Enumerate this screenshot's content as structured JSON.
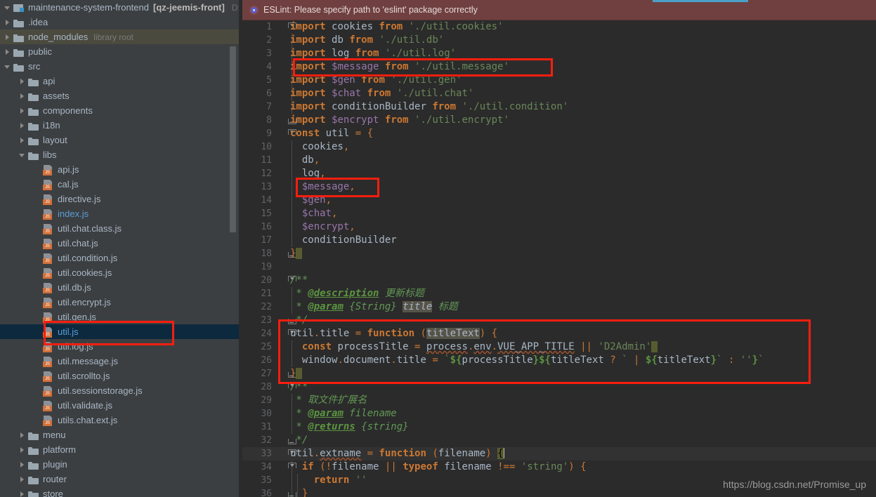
{
  "sidebar": {
    "root": {
      "name": "maintenance-system-frontend",
      "module": "[qz-jeemis-front]",
      "path": "D:\\c"
    },
    "items": [
      {
        "label": ".idea",
        "icon": "folder-icon",
        "arrow": "right",
        "indent": 1
      },
      {
        "label": "node_modules",
        "sub": "library root",
        "icon": "folder-icon",
        "arrow": "right",
        "indent": 1,
        "state": "hovered"
      },
      {
        "label": "public",
        "icon": "folder-icon",
        "arrow": "right",
        "indent": 1
      },
      {
        "label": "src",
        "icon": "folder-icon",
        "arrow": "down",
        "indent": 1
      },
      {
        "label": "api",
        "icon": "folder-icon",
        "arrow": "right",
        "indent": 2
      },
      {
        "label": "assets",
        "icon": "folder-icon",
        "arrow": "right",
        "indent": 2
      },
      {
        "label": "components",
        "icon": "folder-icon",
        "arrow": "right",
        "indent": 2
      },
      {
        "label": "i18n",
        "icon": "folder-icon",
        "arrow": "right",
        "indent": 2
      },
      {
        "label": "layout",
        "icon": "folder-icon",
        "arrow": "right",
        "indent": 2
      },
      {
        "label": "libs",
        "icon": "folder-icon",
        "arrow": "down",
        "indent": 2
      },
      {
        "label": "api.js",
        "icon": "js-file-icon",
        "arrow": "none",
        "indent": 3
      },
      {
        "label": "cal.js",
        "icon": "js-file-icon",
        "arrow": "none",
        "indent": 3
      },
      {
        "label": "directive.js",
        "icon": "js-file-icon",
        "arrow": "none",
        "indent": 3
      },
      {
        "label": "index.js",
        "icon": "js-file-icon",
        "arrow": "none",
        "indent": 3,
        "color": "blue"
      },
      {
        "label": "util.chat.class.js",
        "icon": "js-file-icon",
        "arrow": "none",
        "indent": 3
      },
      {
        "label": "util.chat.js",
        "icon": "js-file-icon",
        "arrow": "none",
        "indent": 3
      },
      {
        "label": "util.condition.js",
        "icon": "js-file-icon",
        "arrow": "none",
        "indent": 3
      },
      {
        "label": "util.cookies.js",
        "icon": "js-file-icon",
        "arrow": "none",
        "indent": 3
      },
      {
        "label": "util.db.js",
        "icon": "js-file-icon",
        "arrow": "none",
        "indent": 3
      },
      {
        "label": "util.encrypt.js",
        "icon": "js-file-icon",
        "arrow": "none",
        "indent": 3
      },
      {
        "label": "util.gen.js",
        "icon": "js-file-icon",
        "arrow": "none",
        "indent": 3
      },
      {
        "label": "util.js",
        "icon": "js-file-icon",
        "arrow": "none",
        "indent": 3,
        "color": "blue",
        "state": "selected"
      },
      {
        "label": "util.log.js",
        "icon": "js-file-icon",
        "arrow": "none",
        "indent": 3
      },
      {
        "label": "util.message.js",
        "icon": "js-file-icon",
        "arrow": "none",
        "indent": 3
      },
      {
        "label": "util.scrollto.js",
        "icon": "js-file-icon",
        "arrow": "none",
        "indent": 3
      },
      {
        "label": "util.sessionstorage.js",
        "icon": "js-file-icon",
        "arrow": "none",
        "indent": 3
      },
      {
        "label": "util.validate.js",
        "icon": "js-file-icon",
        "arrow": "none",
        "indent": 3
      },
      {
        "label": "utils.chat.ext.js",
        "icon": "js-file-icon",
        "arrow": "none",
        "indent": 3
      },
      {
        "label": "menu",
        "icon": "folder-icon",
        "arrow": "right",
        "indent": 2
      },
      {
        "label": "platform",
        "icon": "folder-icon",
        "arrow": "right",
        "indent": 2
      },
      {
        "label": "plugin",
        "icon": "folder-icon",
        "arrow": "right",
        "indent": 2
      },
      {
        "label": "router",
        "icon": "folder-icon",
        "arrow": "right",
        "indent": 2
      },
      {
        "label": "store",
        "icon": "folder-icon",
        "arrow": "right",
        "indent": 2
      }
    ]
  },
  "notification": {
    "text": "ESLint: Please specify path to 'eslint' package correctly",
    "icon": "error-circle-icon",
    "background": "#704040"
  },
  "editor": {
    "file": "util.js",
    "first_line": 1,
    "last_line": 36,
    "lines": [
      {
        "n": 1,
        "text": "import cookies from './util.cookies'"
      },
      {
        "n": 2,
        "text": "import db from './util.db'"
      },
      {
        "n": 3,
        "text": "import log from './util.log'"
      },
      {
        "n": 4,
        "text": "import $message from './util.message'"
      },
      {
        "n": 5,
        "text": "import $gen from './util.gen'"
      },
      {
        "n": 6,
        "text": "import $chat from './util.chat'"
      },
      {
        "n": 7,
        "text": "import conditionBuilder from './util.condition'"
      },
      {
        "n": 8,
        "text": "import $encrypt from './util.encrypt'"
      },
      {
        "n": 9,
        "text": "const util = {"
      },
      {
        "n": 10,
        "text": "  cookies,"
      },
      {
        "n": 11,
        "text": "  db,"
      },
      {
        "n": 12,
        "text": "  log,"
      },
      {
        "n": 13,
        "text": "  $message,"
      },
      {
        "n": 14,
        "text": "  $gen,"
      },
      {
        "n": 15,
        "text": "  $chat,"
      },
      {
        "n": 16,
        "text": "  $encrypt,"
      },
      {
        "n": 17,
        "text": "  conditionBuilder"
      },
      {
        "n": 18,
        "text": "}"
      },
      {
        "n": 19,
        "text": ""
      },
      {
        "n": 20,
        "text": "/**"
      },
      {
        "n": 21,
        "text": " * @description 更新标题"
      },
      {
        "n": 22,
        "text": " * @param {String} title 标题"
      },
      {
        "n": 23,
        "text": " */"
      },
      {
        "n": 24,
        "text": "util.title = function (titleText) {"
      },
      {
        "n": 25,
        "text": "  const processTitle = process.env.VUE_APP_TITLE || 'D2Admin'"
      },
      {
        "n": 26,
        "text": "  window.document.title = `${processTitle}${titleText ? ` | ${titleText}` : ''}`"
      },
      {
        "n": 27,
        "text": "}"
      },
      {
        "n": 28,
        "text": "/**"
      },
      {
        "n": 29,
        "text": " * 取文件扩展名"
      },
      {
        "n": 30,
        "text": " * @param filename"
      },
      {
        "n": 31,
        "text": " * @returns {string}"
      },
      {
        "n": 32,
        "text": " */"
      },
      {
        "n": 33,
        "text": "util.extname = function (filename) {"
      },
      {
        "n": 34,
        "text": "  if (!filename || typeof filename !== 'string') {"
      },
      {
        "n": 35,
        "text": "    return ''"
      },
      {
        "n": 36,
        "text": "  }"
      }
    ]
  },
  "annotations": {
    "color": "#fa1e0e",
    "boxes": [
      {
        "name": "import-message-highlight",
        "target_line": 4
      },
      {
        "name": "message-key-highlight",
        "target_line": 13
      },
      {
        "name": "util-title-function-highlight",
        "target_lines": "23-28"
      },
      {
        "name": "util-js-file-highlight",
        "target": "util.js"
      }
    ]
  },
  "watermark": {
    "text": "https://blog.csdn.net/Promise_up"
  }
}
